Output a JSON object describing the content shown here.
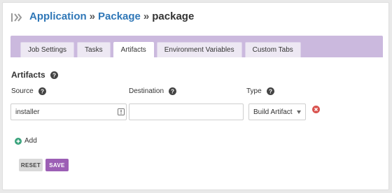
{
  "breadcrumb": {
    "items": [
      "Application",
      "Package"
    ],
    "separator": "»",
    "current": "package"
  },
  "tabs": [
    {
      "label": "Job Settings",
      "active": false
    },
    {
      "label": "Tasks",
      "active": false
    },
    {
      "label": "Artifacts",
      "active": true
    },
    {
      "label": "Environment Variables",
      "active": false
    },
    {
      "label": "Custom Tabs",
      "active": false
    }
  ],
  "artifacts": {
    "title": "Artifacts",
    "labels": {
      "source": "Source",
      "destination": "Destination",
      "type": "Type"
    },
    "row": {
      "source_value": "installer",
      "destination_value": "",
      "type_value": "Build Artifact"
    },
    "add_label": "Add"
  },
  "actions": {
    "reset_label": "RESET",
    "save_label": "SAVE"
  },
  "colors": {
    "link": "#2f77b7",
    "tab_bar": "#cbb9de",
    "save_button": "#9c5fb5",
    "remove_icon": "#d9534f",
    "add_icon": "#3aa37c"
  },
  "icons": {
    "logo": "pipeline-logo-icon",
    "help": "question-circle-icon",
    "remove": "close-circle-icon",
    "add": "plus-circle-icon",
    "input_helper": "list-icon",
    "caret": "caret-down-icon"
  }
}
